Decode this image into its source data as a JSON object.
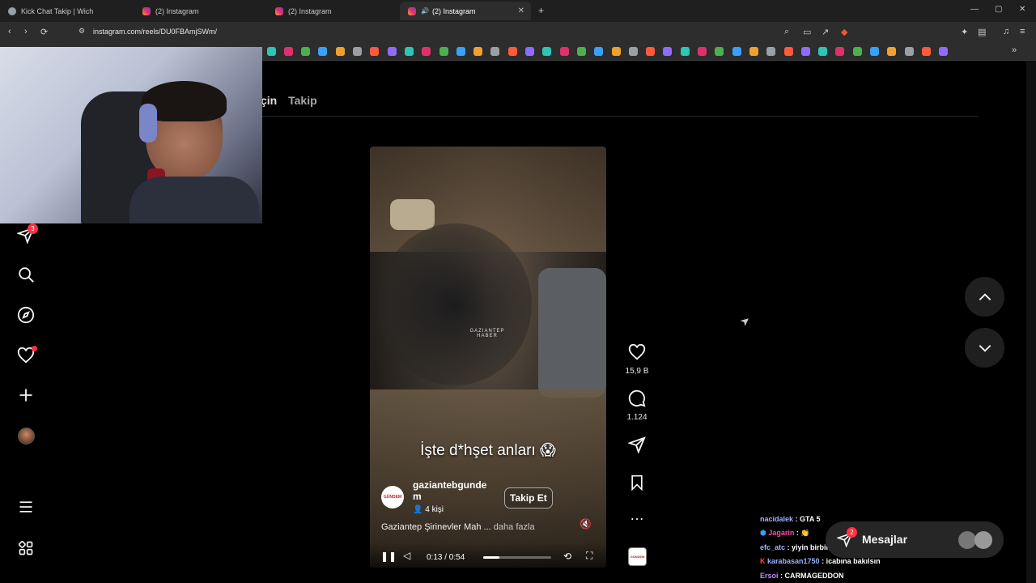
{
  "browser": {
    "tabs": [
      {
        "title": "Kick Chat Takip | Wich",
        "active": false
      },
      {
        "title": "(2) Instagram",
        "active": false
      },
      {
        "title": "(2) Instagram",
        "active": false
      },
      {
        "title": "(2) Instagram",
        "active": true
      }
    ],
    "new_tab_glyph": "+",
    "url": "instagram.com/reels/DU0FBAmjSWm/"
  },
  "feed_tabs": [
    "Senin için",
    "Takip"
  ],
  "feed_tabs_visible": [
    "çin",
    "Takip"
  ],
  "sidebar": {
    "messages_badge": "3",
    "items": [
      "search-icon",
      "compass-icon",
      "heart-icon",
      "create-icon",
      "profile-avatar",
      "menu-icon",
      "grid-icon"
    ]
  },
  "reel": {
    "caption_overlay": "İşte d*hşet anları 😱",
    "watermark_line1": "GAZIANTEP",
    "watermark_line2": "HABER",
    "account_name_line1": "gaziantebgunde",
    "account_name_line2": "m",
    "follow_label": "Takip Et",
    "people_label": "4 kişi",
    "description": "Gaziantep Şirinevler Mah ...",
    "more_label": "daha fazla",
    "time": "0:13 / 0:54",
    "progress": 0.24,
    "avatar_text": "GÜNDEM"
  },
  "actions": {
    "likes": "15,9 B",
    "comments": "1.124",
    "more_glyph": "…"
  },
  "chat": [
    {
      "user": "nacidalek",
      "text": "GTA 5",
      "color": "#9ab4ff"
    },
    {
      "user": "Jagarin",
      "text": "👏",
      "color": "#ff4da6"
    },
    {
      "user": "efc_atc",
      "text": "yiyin birbirinizi amk",
      "color": "#9ab4ff"
    },
    {
      "user": "karabasan1750",
      "text": "icabına bakılsın",
      "color": "#9ab4ff"
    },
    {
      "user": "Ersoi",
      "text": "CARMAGEDDON",
      "color": "#c58bff"
    }
  ],
  "messages_bar": {
    "label": "Mesajlar",
    "badge": "2"
  },
  "colors": {
    "accent_red": "#ff3040",
    "page_bg": "#000000",
    "chrome_bg": "#2d2d2d"
  }
}
